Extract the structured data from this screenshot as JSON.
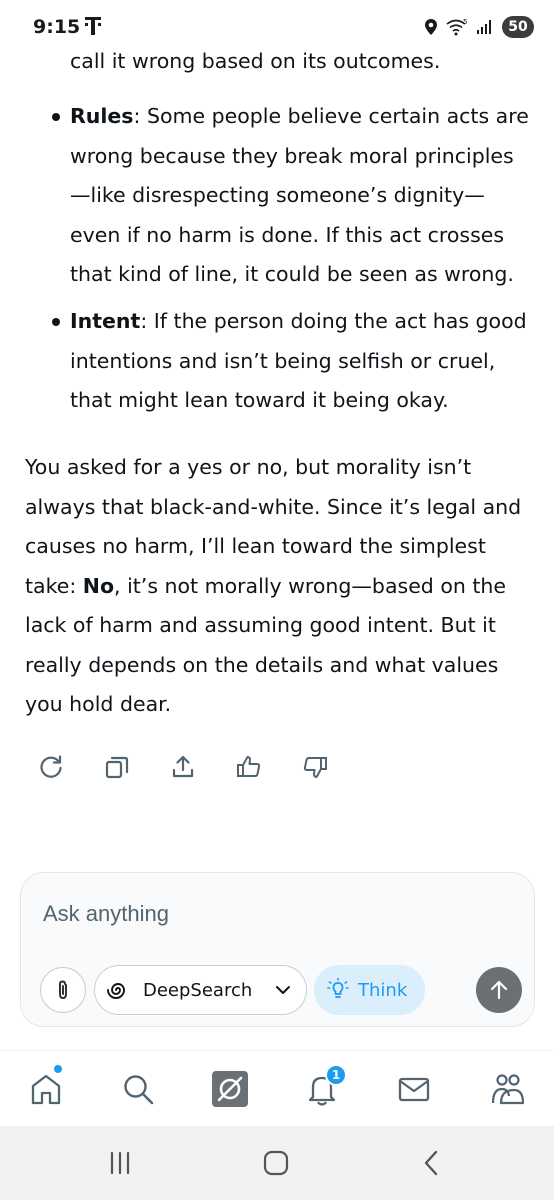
{
  "status_bar": {
    "time": "9:15",
    "carrier_icon": "t-mobile-logo",
    "wifi_label": "5",
    "battery": "50"
  },
  "content": {
    "cut_line": "call it wrong based on its outcomes.",
    "bullets": [
      {
        "term": "Rules",
        "lines": [
          ": Some people believe certain acts are",
          "wrong because they break moral principles",
          "—like disrespecting someone’s dignity—",
          "even if no harm is done. If this act crosses",
          "that kind of line, it could be seen as wrong."
        ]
      },
      {
        "term": "Intent",
        "lines": [
          ": If the person doing the act has good",
          "intentions and isn’t being selfish or cruel,",
          "that might lean toward it being okay."
        ]
      }
    ],
    "paragraph": {
      "line1": "You asked for a yes or no, but morality isn’t",
      "line2": "always that black-and-white. Since it’s legal and",
      "line3": "causes no harm, I’ll lean toward the simplest",
      "line4_before": "take: ",
      "line4_bold": "No",
      "line4_after": ", it’s not morally wrong—based on the",
      "line5": "lack of harm and assuming good intent. But it",
      "line6": "really depends on the details and what values",
      "line7": "you hold dear."
    }
  },
  "actions": [
    "regenerate-icon",
    "copy-icon",
    "share-icon",
    "thumbs-up-icon",
    "thumbs-down-icon"
  ],
  "compose": {
    "placeholder": "Ask anything",
    "deepsearch_label": "DeepSearch",
    "think_label": "Think"
  },
  "bottom_nav": {
    "items": [
      "home-icon",
      "search-icon",
      "grok-icon",
      "notifications-icon",
      "messages-icon",
      "communities-icon"
    ],
    "notification_count": "1"
  },
  "colors": {
    "accent": "#1d9bf0",
    "text": "#0f1419",
    "muted": "#536471",
    "send_button": "#6b7075",
    "think_bg": "#dbeefc"
  }
}
